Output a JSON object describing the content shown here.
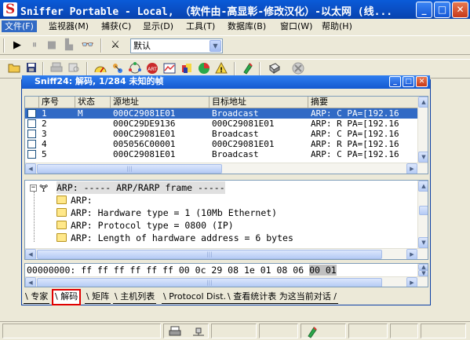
{
  "window": {
    "title": "Sniffer Portable - Local, （软件由-高显彰-修改汉化）-以太网 (线...",
    "minimize": "_",
    "maximize": "□",
    "close": "✕"
  },
  "menu": [
    {
      "label": "文件(F)",
      "active": true
    },
    {
      "label": "监视器(M)"
    },
    {
      "label": "捕获(C)"
    },
    {
      "label": "显示(D)"
    },
    {
      "label": "工具(T)"
    },
    {
      "label": "数据库(B)"
    },
    {
      "label": "窗口(W)"
    },
    {
      "label": "帮助(H)"
    }
  ],
  "toolbar": {
    "filter_select": "默认",
    "play_icon": "▶",
    "pause_icon": "⏸",
    "stop_icon": "■",
    "stop_display_icon": "▙",
    "binoculars_icon": "👓",
    "filter_icon": "⚔"
  },
  "capture_window": {
    "title": "Sniff24: 解码, 1/284 未知的帧"
  },
  "packet_list": {
    "columns": [
      "序号",
      "状态",
      "源地址",
      "目标地址",
      "摘要"
    ],
    "rows": [
      {
        "no": "1",
        "status": "M",
        "src": "000C29081E01",
        "dst": "Broadcast",
        "summary": "ARP: C PA=[192.16"
      },
      {
        "no": "2",
        "status": "",
        "src": "000C29DE9136",
        "dst": "000C29081E01",
        "summary": "ARP: R PA=[192.16"
      },
      {
        "no": "3",
        "status": "",
        "src": "000C29081E01",
        "dst": "Broadcast",
        "summary": "ARP: C PA=[192.16"
      },
      {
        "no": "4",
        "status": "",
        "src": "005056C00001",
        "dst": "000C29081E01",
        "summary": "ARP: R PA=[192.16"
      },
      {
        "no": "5",
        "status": "",
        "src": "000C29081E01",
        "dst": "Broadcast",
        "summary": "ARP: C PA=[192.16"
      }
    ]
  },
  "decode": {
    "header": "ARP: ----- ARP/RARP frame -----",
    "lines": [
      "ARP:",
      "ARP: Hardware type = 1 (10Mb Ethernet)",
      "ARP: Protocol type = 0800 (IP)",
      "ARP: Length of hardware address = 6 bytes"
    ]
  },
  "hex": {
    "offset": "00000000:",
    "bytes": "ff ff ff ff ff ff 00 0c 29 08 1e 01 08 06",
    "selected": "00 01"
  },
  "tabs": [
    {
      "label": "专家"
    },
    {
      "label": "解码",
      "active": true
    },
    {
      "label": "矩阵"
    },
    {
      "label": "主机列表"
    },
    {
      "label": "Protocol Dist."
    },
    {
      "label": "查看统计表 为这当前对话"
    }
  ]
}
